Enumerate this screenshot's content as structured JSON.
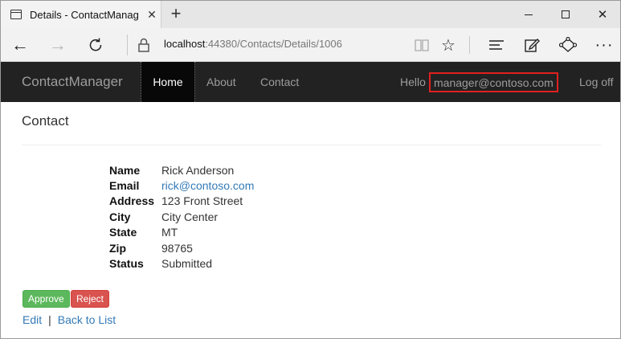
{
  "browser": {
    "tab_title": "Details - ContactManag",
    "tab_close": "✕",
    "new_tab": "+",
    "url_host": "localhost",
    "url_rest": ":44380/Contacts/Details/1006",
    "icons": [
      "page-icon",
      "back-icon",
      "forward-icon",
      "refresh-icon",
      "lock-icon",
      "reading-view-icon",
      "favorite-star-icon",
      "hub-icon",
      "web-note-icon",
      "share-icon",
      "more-icon"
    ]
  },
  "navbar": {
    "brand": "ContactManager",
    "items": [
      {
        "label": "Home",
        "active": true
      },
      {
        "label": "About",
        "active": false
      },
      {
        "label": "Contact",
        "active": false
      }
    ],
    "hello": "Hello",
    "user_email": "manager@contoso.com",
    "logoff": "Log off"
  },
  "page": {
    "heading": "Contact",
    "fields": [
      {
        "label": "Name",
        "value": "Rick Anderson"
      },
      {
        "label": "Email",
        "value": "rick@contoso.com"
      },
      {
        "label": "Address",
        "value": "123 Front Street"
      },
      {
        "label": "City",
        "value": "City Center"
      },
      {
        "label": "State",
        "value": "MT"
      },
      {
        "label": "Zip",
        "value": "98765"
      },
      {
        "label": "Status",
        "value": "Submitted"
      }
    ],
    "approve_label": "Approve",
    "reject_label": "Reject",
    "edit_label": "Edit",
    "separator": "|",
    "back_label": "Back to List"
  },
  "colors": {
    "navbar_bg": "#222222",
    "highlight_border": "#e02020",
    "approve": "#5cb85c",
    "reject": "#d9534f",
    "link": "#337ab7"
  }
}
